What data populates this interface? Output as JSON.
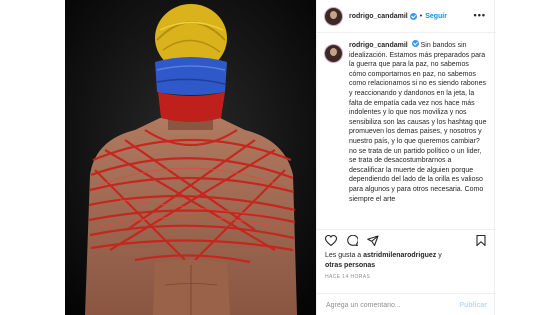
{
  "post": {
    "username": "rodrigo_candamil",
    "follow_label": "Seguir",
    "separator": "•",
    "more_label": "•••",
    "caption": "Sin bandos sin idealización. Estamos más preparados para la guerra que para la paz, no sabemos cómo comportarnos en paz, no sabemos como relacionarnos si no es siendo rabones y reaccionando y dandonos en la jeta, la falta de empatía cada vez nos hace más indolentes y lo que nos moviliza y nos sensibiliza son las causas y los hashtag que promueven los demas paises, y nosotros y nuestro país, y lo que queremos cambiar? no se trata de un partido político o un lider, se trata de desacostumbrarnos a descalificar la muerte de alguien porque dependiendo del lado de la orilla es valioso para algunos y para otros necesaria. Como siempre el arte"
  },
  "engagement": {
    "likes_prefix": "Les gusta a ",
    "liked_by_user": "astridmilenarodriguez",
    "likes_connector": " y",
    "others_label": "otras personas",
    "timestamp": "HACE 14 HORAS"
  },
  "comment": {
    "placeholder": "Agrega un comentario...",
    "publish_label": "Publicar"
  },
  "icons": {
    "like": "heart-icon",
    "comment": "comment-icon",
    "share": "share-icon",
    "save": "bookmark-icon",
    "verified": "verified-badge-icon"
  },
  "colors": {
    "follow": "#0095f6",
    "verified": "#3897f0",
    "publish_disabled": "#b2dffc",
    "muted": "#8e8e8e"
  }
}
